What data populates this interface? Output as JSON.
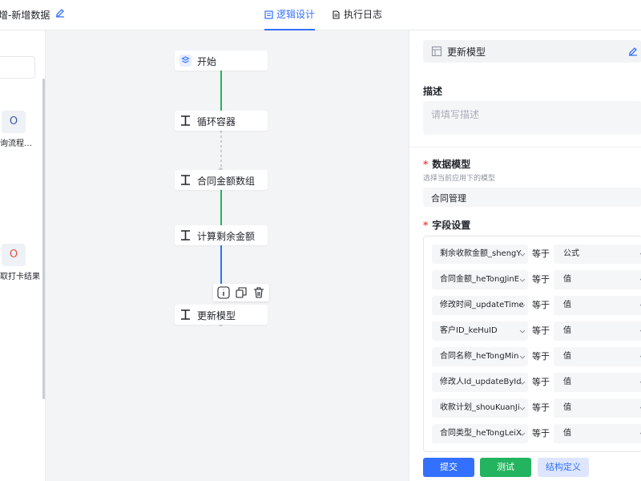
{
  "header": {
    "title": "新增-新增数据",
    "tabs": [
      {
        "label": "逻辑设计",
        "active": true,
        "icon": "design-doc-icon"
      },
      {
        "label": "执行日志",
        "active": false,
        "icon": "log-doc-icon"
      }
    ]
  },
  "left_panel": {
    "items": [
      {
        "glyph": "O",
        "label": "询流程…",
        "color": "#3d5aa8"
      },
      {
        "glyph": "O",
        "label": "取打卡结果",
        "color": "#e0533f"
      }
    ]
  },
  "canvas": {
    "nodes": [
      {
        "label": "开始",
        "icon": "layers-icon"
      },
      {
        "label": "循环容器",
        "icon": "i-beam-icon"
      },
      {
        "label": "合同金额数组",
        "icon": "i-beam-icon"
      },
      {
        "label": "计算剩余金额",
        "icon": "i-beam-icon"
      },
      {
        "label": "更新模型",
        "icon": "i-beam-icon"
      }
    ],
    "connector_colors": [
      "#24b35e",
      "#c9cdd4",
      "#24b35e",
      "#24b35e",
      "#3370ff"
    ],
    "toolbar_icons": [
      "info-icon",
      "copy-icon",
      "delete-icon"
    ]
  },
  "right_panel": {
    "title": "更新模型",
    "description_label": "描述",
    "description_placeholder": "请填写描述",
    "data_model_label": "数据模型",
    "data_model_hint": "选择当前应用下的模型",
    "data_model_value": "合同管理",
    "fields_label": "字段设置",
    "fields": [
      {
        "field": "剩余收款金额_shengY",
        "op": "等于",
        "value": "公式"
      },
      {
        "field": "合同金额_heTongJinE",
        "op": "等于",
        "value": "值"
      },
      {
        "field": "修改时间_updateTime",
        "op": "等于",
        "value": "值"
      },
      {
        "field": "客户ID_keHuID",
        "op": "等于",
        "value": "值"
      },
      {
        "field": "合同名称_heTongMin",
        "op": "等于",
        "value": "值"
      },
      {
        "field": "修改人Id_updateById",
        "op": "等于",
        "value": "值"
      },
      {
        "field": "收款计划_shouKuanJi",
        "op": "等于",
        "value": "值"
      },
      {
        "field": "合同类型_heTongLeiX",
        "op": "等于",
        "value": "值"
      }
    ],
    "buttons": {
      "submit": "提交",
      "test": "测试",
      "struct": "结构定义"
    }
  },
  "colors": {
    "accent": "#3370ff",
    "success": "#24b35e",
    "required": "#f54a45"
  }
}
